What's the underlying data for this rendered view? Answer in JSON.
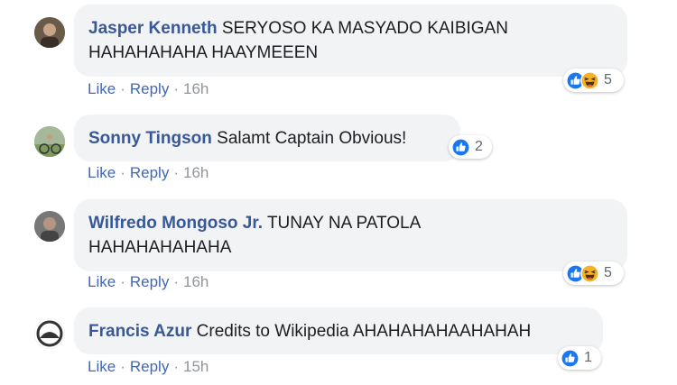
{
  "comments": [
    {
      "author": "Jasper Kenneth",
      "text_line1": "SERYOSO KA MASYADO KAIBIGAN",
      "text_line2": "HAHAHAHAHA HAAYMEEEN",
      "like_label": "Like",
      "reply_label": "Reply",
      "time": "16h",
      "reactions": [
        "like",
        "haha"
      ],
      "reaction_count": "5"
    },
    {
      "author": "Sonny Tingson",
      "text_line1": "Salamt Captain Obvious!",
      "like_label": "Like",
      "reply_label": "Reply",
      "time": "16h",
      "reactions": [
        "like"
      ],
      "reaction_count": "2"
    },
    {
      "author": "Wilfredo Mongoso Jr.",
      "text_line1": "TUNAY NA PATOLA",
      "text_line2": "HAHAHAHAHAHA",
      "like_label": "Like",
      "reply_label": "Reply",
      "time": "16h",
      "reactions": [
        "like",
        "haha"
      ],
      "reaction_count": "5"
    },
    {
      "author": "Francis Azur",
      "text_line1": "Credits to Wikipedia AHAHAHAHAAHAHAH",
      "like_label": "Like",
      "reply_label": "Reply",
      "time": "15h",
      "reactions": [
        "like"
      ],
      "reaction_count": "1"
    }
  ],
  "separator": "·",
  "colors": {
    "author": "#385898",
    "link": "#4267b2",
    "bubble": "#f2f3f5",
    "like_blue": "#1877f2",
    "haha_yellow": "#f7b125"
  }
}
